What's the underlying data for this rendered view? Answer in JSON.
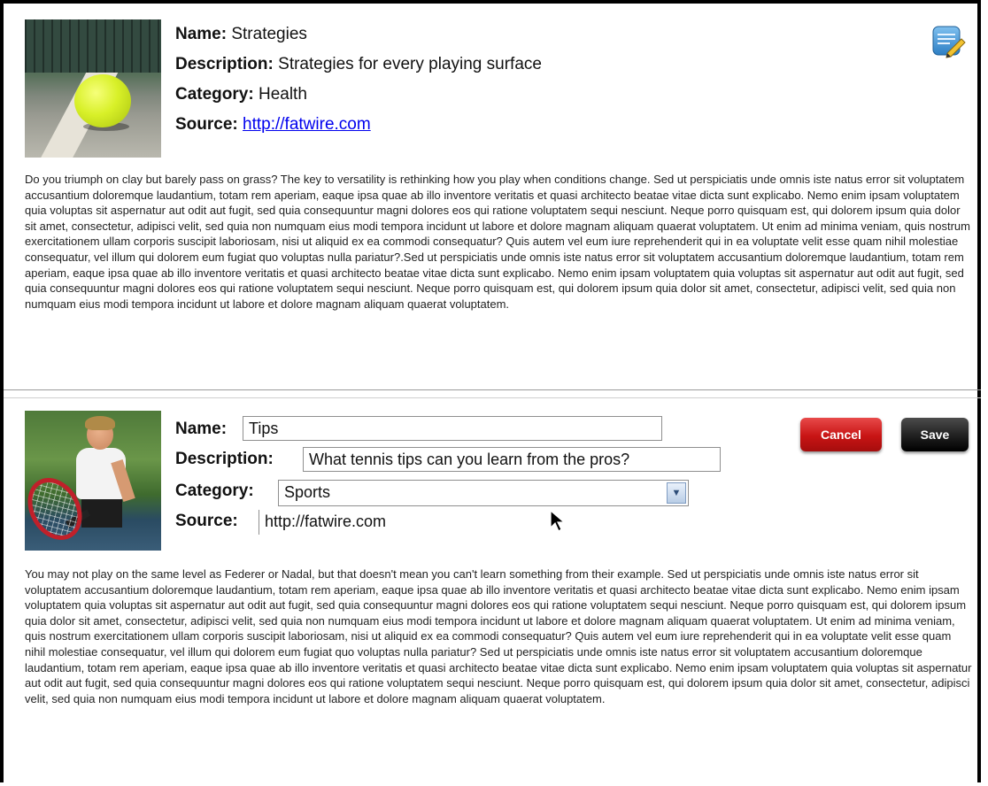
{
  "record1": {
    "name_label": "Name:",
    "name_value": "Strategies",
    "description_label": "Description:",
    "description_value": "Strategies for every playing surface",
    "category_label": "Category:",
    "category_value": "Health",
    "source_label": "Source:",
    "source_value": "http://fatwire.com",
    "edit_icon": "edit-note-icon",
    "body": "Do you triumph on clay but barely pass on grass? The key to versatility is rethinking how you play when conditions change. Sed ut perspiciatis unde omnis iste natus error sit voluptatem accusantium doloremque laudantium, totam rem aperiam, eaque ipsa quae ab illo inventore veritatis et quasi architecto beatae vitae dicta sunt explicabo. Nemo enim ipsam voluptatem quia voluptas sit aspernatur aut odit aut fugit, sed quia consequuntur magni dolores eos qui ratione voluptatem sequi nesciunt. Neque porro quisquam est, qui dolorem ipsum quia dolor sit amet, consectetur, adipisci velit, sed quia non numquam eius modi tempora incidunt ut labore et dolore magnam aliquam quaerat voluptatem. Ut enim ad minima veniam, quis nostrum exercitationem ullam corporis suscipit laboriosam, nisi ut aliquid ex ea commodi consequatur? Quis autem vel eum iure reprehenderit qui in ea voluptate velit esse quam nihil molestiae consequatur, vel illum qui dolorem eum fugiat quo voluptas nulla pariatur?.Sed ut perspiciatis unde omnis iste natus error sit voluptatem accusantium doloremque laudantium, totam rem aperiam, eaque ipsa quae ab illo inventore veritatis et quasi architecto beatae vitae dicta sunt explicabo. Nemo enim ipsam voluptatem quia voluptas sit aspernatur aut odit aut fugit, sed quia consequuntur magni dolores eos qui ratione voluptatem sequi nesciunt. Neque porro quisquam est, qui dolorem ipsum quia dolor sit amet, consectetur, adipisci velit, sed quia non numquam eius modi tempora incidunt ut labore et dolore magnam aliquam quaerat voluptatem."
  },
  "record2": {
    "name_label": "Name:",
    "name_value": "Tips",
    "description_label": "Description:",
    "description_value": "What tennis tips can you learn from the pros?",
    "category_label": "Category:",
    "category_value": "Sports",
    "source_label": "Source:",
    "source_value": "http://fatwire.com",
    "cancel_label": "Cancel",
    "save_label": "Save",
    "body": "You may not play on the same level as Federer or Nadal, but that doesn't mean you can't learn something from their example. Sed ut perspiciatis unde omnis iste natus error sit voluptatem accusantium doloremque laudantium, totam rem aperiam, eaque ipsa quae ab illo inventore veritatis et quasi architecto beatae vitae dicta sunt explicabo. Nemo enim ipsam voluptatem quia voluptas sit aspernatur aut odit aut fugit, sed quia consequuntur magni dolores eos qui ratione voluptatem sequi nesciunt. Neque porro quisquam est, qui dolorem ipsum quia dolor sit amet, consectetur, adipisci velit, sed quia non numquam eius modi tempora incidunt ut labore et dolore magnam aliquam quaerat voluptatem. Ut enim ad minima veniam, quis nostrum exercitationem ullam corporis suscipit laboriosam, nisi ut aliquid ex ea commodi consequatur? Quis autem vel eum iure reprehenderit qui in ea voluptate velit esse quam nihil molestiae consequatur, vel illum qui dolorem eum fugiat quo voluptas nulla pariatur? Sed ut perspiciatis unde omnis iste natus error sit voluptatem accusantium doloremque laudantium, totam rem aperiam, eaque ipsa quae ab illo inventore veritatis et quasi architecto beatae vitae dicta sunt explicabo. Nemo enim ipsam voluptatem quia voluptas sit aspernatur aut odit aut fugit, sed quia consequuntur magni dolores eos qui ratione voluptatem sequi nesciunt. Neque porro quisquam est, qui dolorem ipsum quia dolor sit amet, consectetur, adipisci velit, sed quia non numquam eius modi tempora incidunt ut labore et dolore magnam aliquam quaerat voluptatem."
  },
  "colors": {
    "cancel": "#c81414",
    "save": "#1f1f1f",
    "link": "#0000ee"
  }
}
